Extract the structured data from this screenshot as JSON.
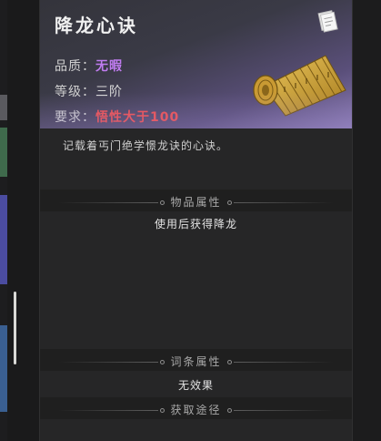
{
  "item": {
    "name": "降龙心诀",
    "quality_label": "品质：",
    "quality_value": "无暇",
    "grade_label": "等级：",
    "grade_value": "三阶",
    "requirement_label": "要求：",
    "requirement_value": "悟性大于100",
    "description": "记载着丐门绝学憬龙诀的心诀。"
  },
  "sections": {
    "item_attributes": {
      "title": "物品属性",
      "value": "使用后获得降龙"
    },
    "entry_attributes": {
      "title": "词条属性",
      "value": "无效果"
    },
    "obtain": {
      "title": "获取途径"
    }
  },
  "colors": {
    "quality": "#c07cf0",
    "requirement": "#f05050",
    "header_gradient_end": "#8b7bb4"
  },
  "icons": {
    "note": "note-paper-icon",
    "item": "bamboo-scroll-icon"
  }
}
